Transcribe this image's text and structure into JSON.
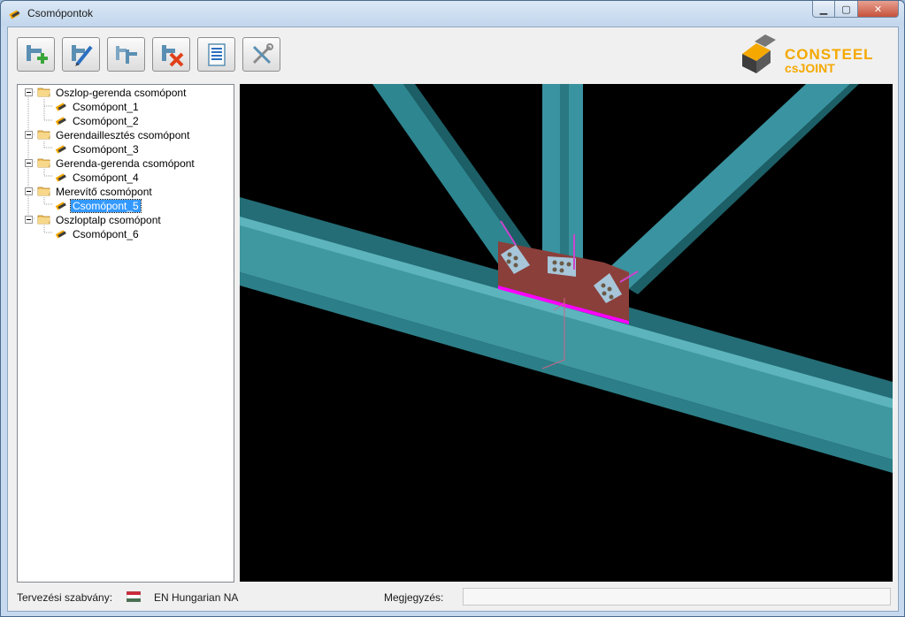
{
  "window": {
    "title": "Csomópontok"
  },
  "toolbar": {
    "buttons": [
      {
        "icon": "add-node-icon"
      },
      {
        "icon": "edit-node-icon"
      },
      {
        "icon": "copy-node-icon"
      },
      {
        "icon": "delete-node-icon"
      },
      {
        "icon": "report-icon"
      },
      {
        "icon": "settings-tools-icon"
      }
    ]
  },
  "logo": {
    "top": "CONSTEEL",
    "bottom": "csJOINT",
    "brand_color": "#f5a800",
    "mark_color": "#555555"
  },
  "tree": {
    "groups": [
      {
        "label": "Oszlop-gerenda csomópont",
        "items": [
          "Csomópont_1",
          "Csomópont_2"
        ]
      },
      {
        "label": "Gerendaillesztés csomópont",
        "items": [
          "Csomópont_3"
        ]
      },
      {
        "label": "Gerenda-gerenda csomópont",
        "items": [
          "Csomópont_4"
        ]
      },
      {
        "label": "Merevítő csomópont",
        "items": [
          "Csomópont_5"
        ]
      },
      {
        "label": "Oszloptalp csomópont",
        "items": [
          "Csomópont_6"
        ]
      }
    ],
    "selected": "Csomópont_5"
  },
  "viewport": {
    "background": "#000000",
    "steel_color": "#3a8c96",
    "plate_color": "#8b3f3a",
    "weld_color": "#ff00ff"
  },
  "status": {
    "standard_label": "Tervezési szabvány:",
    "standard_value": "EN Hungarian NA",
    "note_label": "Megjegyzés:",
    "note_value": ""
  }
}
